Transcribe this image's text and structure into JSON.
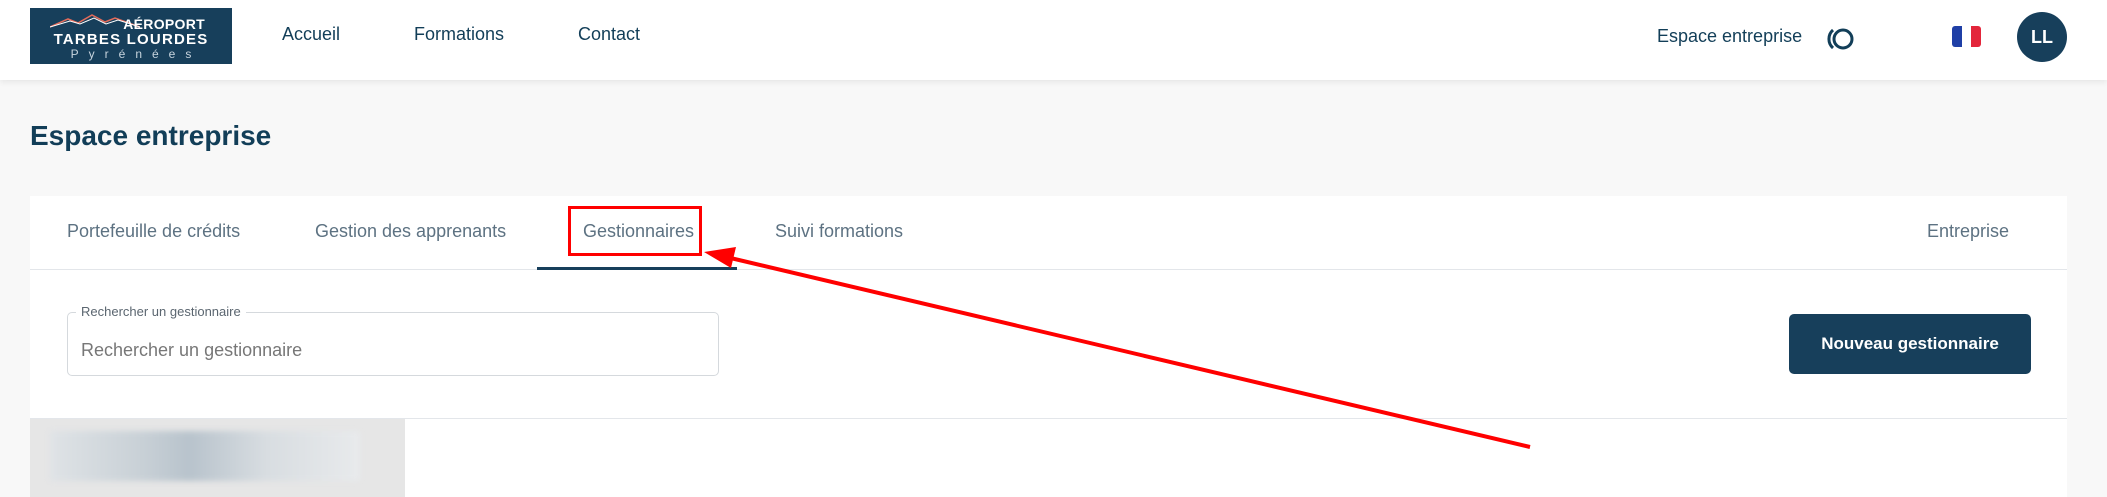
{
  "header": {
    "logo": {
      "line1": "AÉROPORT",
      "line2": "TARBES LOURDES",
      "line3": "Pyrénées"
    },
    "nav": [
      {
        "label": "Accueil"
      },
      {
        "label": "Formations"
      },
      {
        "label": "Contact"
      }
    ],
    "espace_link": "Espace entreprise",
    "loader_icon": "loading-spinner-icon",
    "language_flag": "france-flag-icon",
    "avatar_initials": "LL"
  },
  "page": {
    "title": "Espace entreprise"
  },
  "tabs": [
    {
      "label": "Portefeuille de crédits",
      "active": false
    },
    {
      "label": "Gestion des apprenants",
      "active": false
    },
    {
      "label": "Gestionnaires",
      "active": true
    },
    {
      "label": "Suivi formations",
      "active": false
    },
    {
      "label": "Entreprise",
      "active": false
    }
  ],
  "search": {
    "legend": "Rechercher un gestionnaire",
    "placeholder": "Rechercher un gestionnaire",
    "value": ""
  },
  "actions": {
    "new_manager_label": "Nouveau gestionnaire"
  },
  "colors": {
    "brand": "#173f5b",
    "tab_text": "#5d7282",
    "annotation": "#ff0000",
    "page_bg": "#f8f8f8"
  }
}
